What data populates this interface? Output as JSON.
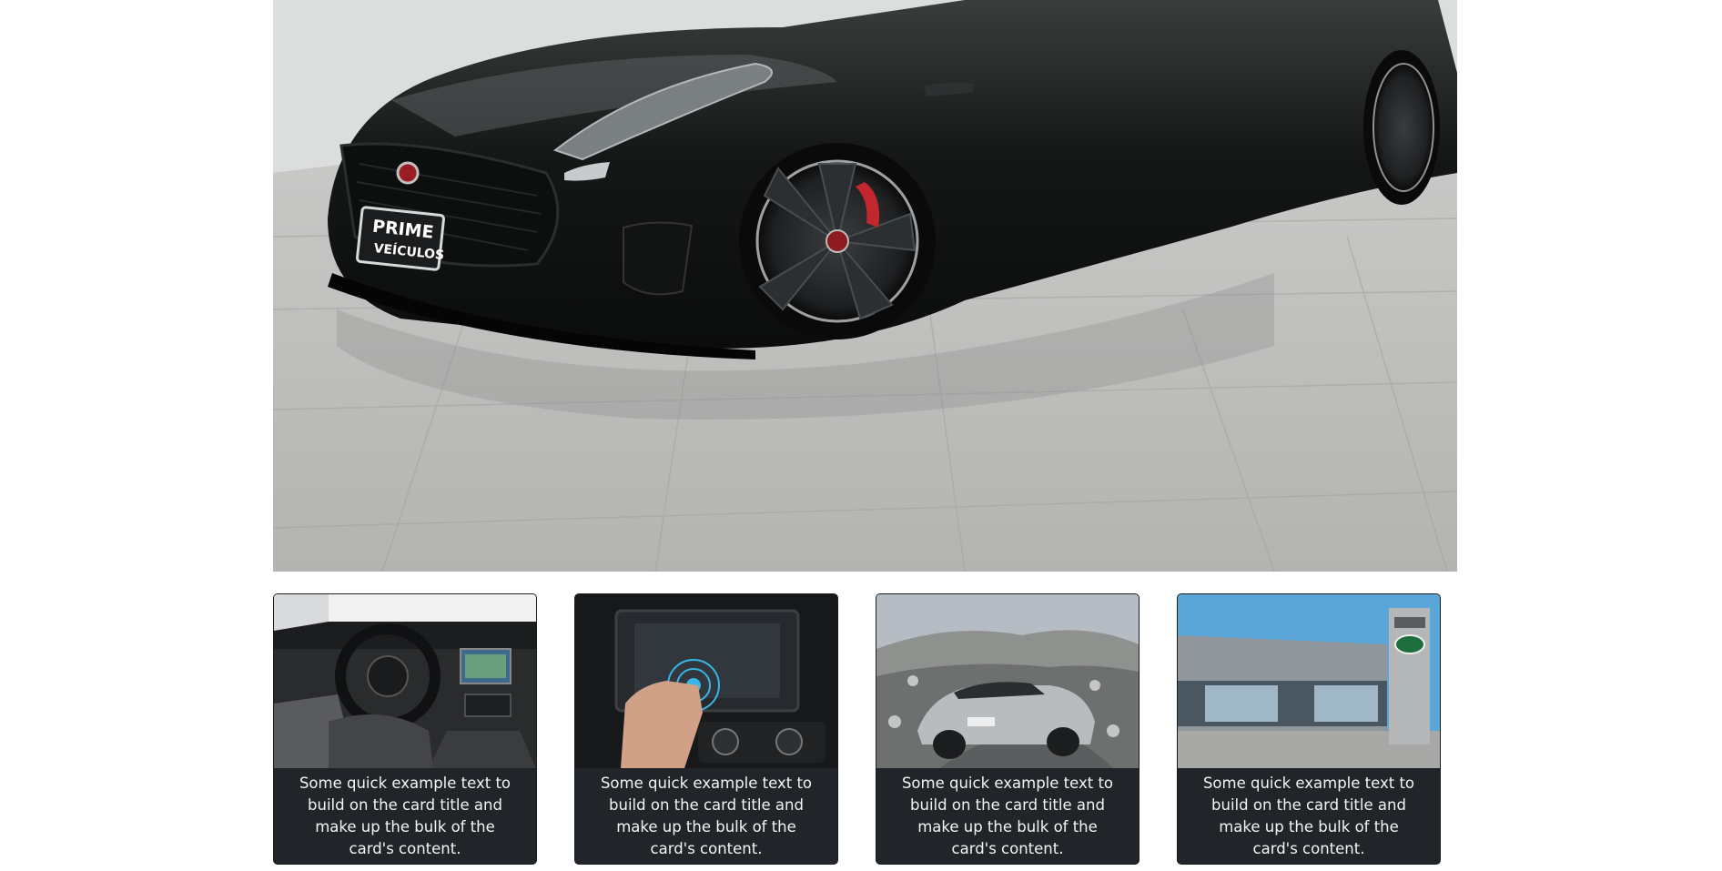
{
  "hero": {
    "image": "black-sports-car-showroom",
    "plate_line1": "PRIME",
    "plate_line2": "VEÍCULOS"
  },
  "cards": [
    {
      "image": "car-interior-dashboard",
      "text": "Some quick example text to build on the card title and make up the bulk of the card's content."
    },
    {
      "image": "touchscreen-infotainment",
      "text": "Some quick example text to build on the card title and make up the bulk of the card's content."
    },
    {
      "image": "silver-coupe-landscape",
      "text": "Some quick example text to build on the card title and make up the bulk of the card's content."
    },
    {
      "image": "jaguar-landrover-dealership",
      "text": "Some quick example text to build on the card title and make up the bulk of the card's content."
    }
  ],
  "colors": {
    "card_background": "#212529",
    "card_text": "#f3f4f5",
    "page_background": "#ffffff"
  }
}
